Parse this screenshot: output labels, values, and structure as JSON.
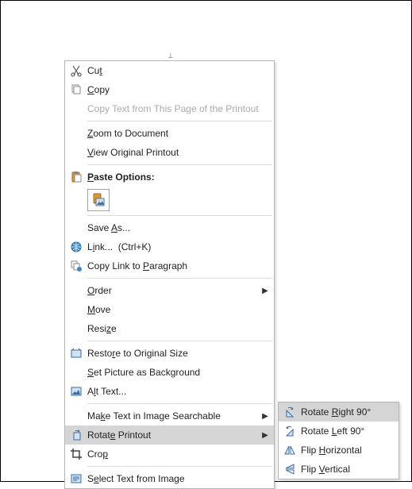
{
  "menu": {
    "cut": {
      "pre": "Cu",
      "hk": "t",
      "post": ""
    },
    "copy": {
      "pre": "",
      "hk": "C",
      "post": "opy"
    },
    "copy_text": {
      "pre": "Copy Text from This Page of the Printout",
      "hk": "",
      "post": ""
    },
    "zoom": {
      "pre": "",
      "hk": "Z",
      "post": "oom to Document"
    },
    "view_orig": {
      "pre": "",
      "hk": "V",
      "post": "iew Original Printout"
    },
    "paste_options": {
      "pre": "",
      "hk": "P",
      "post": "aste Options:"
    },
    "save_as": {
      "pre": "Save ",
      "hk": "A",
      "post": "s..."
    },
    "link": {
      "pre": "L",
      "hk": "i",
      "post": "nk...",
      "accel": "(Ctrl+K)"
    },
    "copy_link": {
      "pre": "Copy Link to ",
      "hk": "P",
      "post": "aragraph"
    },
    "order": {
      "pre": "",
      "hk": "O",
      "post": "rder"
    },
    "move": {
      "pre": "",
      "hk": "M",
      "post": "ove"
    },
    "resize": {
      "pre": "Resi",
      "hk": "z",
      "post": "e"
    },
    "restore": {
      "pre": "Resto",
      "hk": "r",
      "post": "e to Original Size"
    },
    "background": {
      "pre": "",
      "hk": "S",
      "post": "et Picture as Background"
    },
    "alt_text": {
      "pre": "A",
      "hk": "l",
      "post": "t Text..."
    },
    "searchable": {
      "pre": "Ma",
      "hk": "k",
      "post": "e Text in Image Searchable"
    },
    "rotate": {
      "pre": "Rotat",
      "hk": "e",
      "post": " Printout"
    },
    "crop": {
      "pre": "Cro",
      "hk": "p",
      "post": ""
    },
    "select_text": {
      "pre": "S",
      "hk": "e",
      "post": "lect Text from Image"
    }
  },
  "submenu": {
    "right": {
      "pre": "Rotate ",
      "hk": "R",
      "post": "ight 90°"
    },
    "left": {
      "pre": "Rotate ",
      "hk": "L",
      "post": "eft 90°"
    },
    "fliph": {
      "pre": "Flip ",
      "hk": "H",
      "post": "orizontal"
    },
    "flipv": {
      "pre": "Flip ",
      "hk": "V",
      "post": "ertical"
    }
  }
}
